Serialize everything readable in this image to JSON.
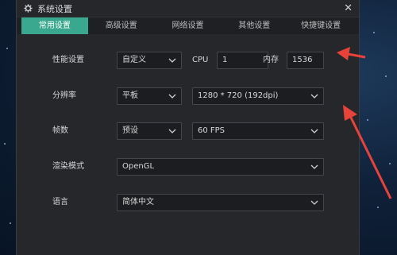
{
  "window": {
    "title": "系统设置",
    "close_glyph": "✕"
  },
  "tabs": [
    {
      "label": "常用设置",
      "active": true
    },
    {
      "label": "高级设置"
    },
    {
      "label": "网络设置"
    },
    {
      "label": "其他设置"
    },
    {
      "label": "快捷键设置"
    }
  ],
  "performance": {
    "label": "性能设置",
    "preset": "自定义",
    "cpu_label": "CPU",
    "cpu_value": "1",
    "memory_label": "内存",
    "memory_value": "1536"
  },
  "resolution": {
    "label": "分辨率",
    "device": "平板",
    "value": "1280 * 720 (192dpi)"
  },
  "fps": {
    "label": "帧数",
    "preset": "预设",
    "value": "60 FPS"
  },
  "render": {
    "label": "渲染模式",
    "value": "OpenGL"
  },
  "language": {
    "label": "语言",
    "value": "简体中文"
  },
  "colors": {
    "accent": "#3aa88e",
    "annotation_arrow": "#e8433a"
  }
}
